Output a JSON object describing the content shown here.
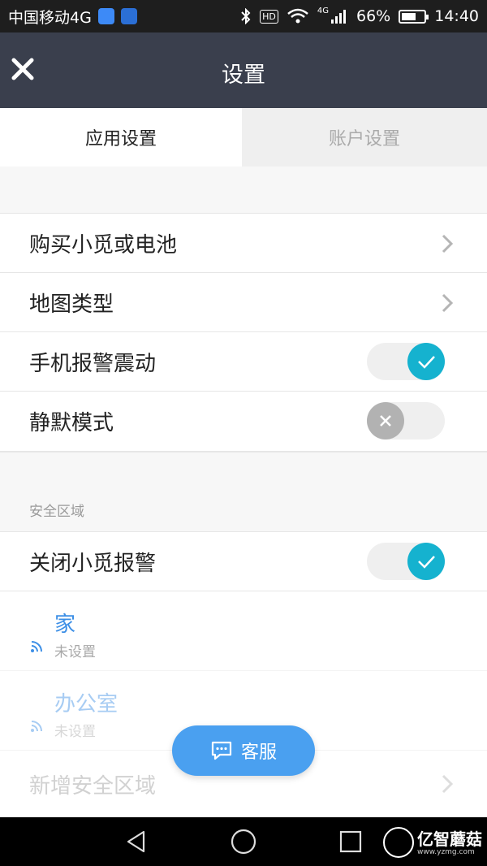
{
  "status_bar": {
    "carrier": "中国移动4G",
    "hd": "HD",
    "net": "4G",
    "battery": "66%",
    "battery_level": 0.66,
    "time": "14:40"
  },
  "header": {
    "title": "设置"
  },
  "tabs": [
    {
      "label": "应用设置",
      "active": true
    },
    {
      "label": "账户设置",
      "active": false
    }
  ],
  "settings": [
    {
      "label": "购买小觅或电池",
      "control": "chevron"
    },
    {
      "label": "地图类型",
      "control": "chevron"
    },
    {
      "label": "手机报警震动",
      "control": "switch",
      "on": true
    },
    {
      "label": "静默模式",
      "control": "switch",
      "on": false
    }
  ],
  "safe_zone": {
    "section_title": "安全区域",
    "close_alarm": {
      "label": "关闭小觅报警",
      "on": true
    },
    "zones": [
      {
        "name": "家",
        "status": "未设置"
      },
      {
        "name": "办公室",
        "status": "未设置"
      }
    ],
    "add_label": "新增安全区域"
  },
  "fab": {
    "label": "客服"
  },
  "watermark": {
    "name": "亿智蘑菇",
    "url": "www.yzmg.com"
  },
  "colors": {
    "accent": "#15b2cf",
    "header_bg": "#3a3f4d",
    "link_blue": "#3d8fe6",
    "fab": "#4aa0f0"
  }
}
